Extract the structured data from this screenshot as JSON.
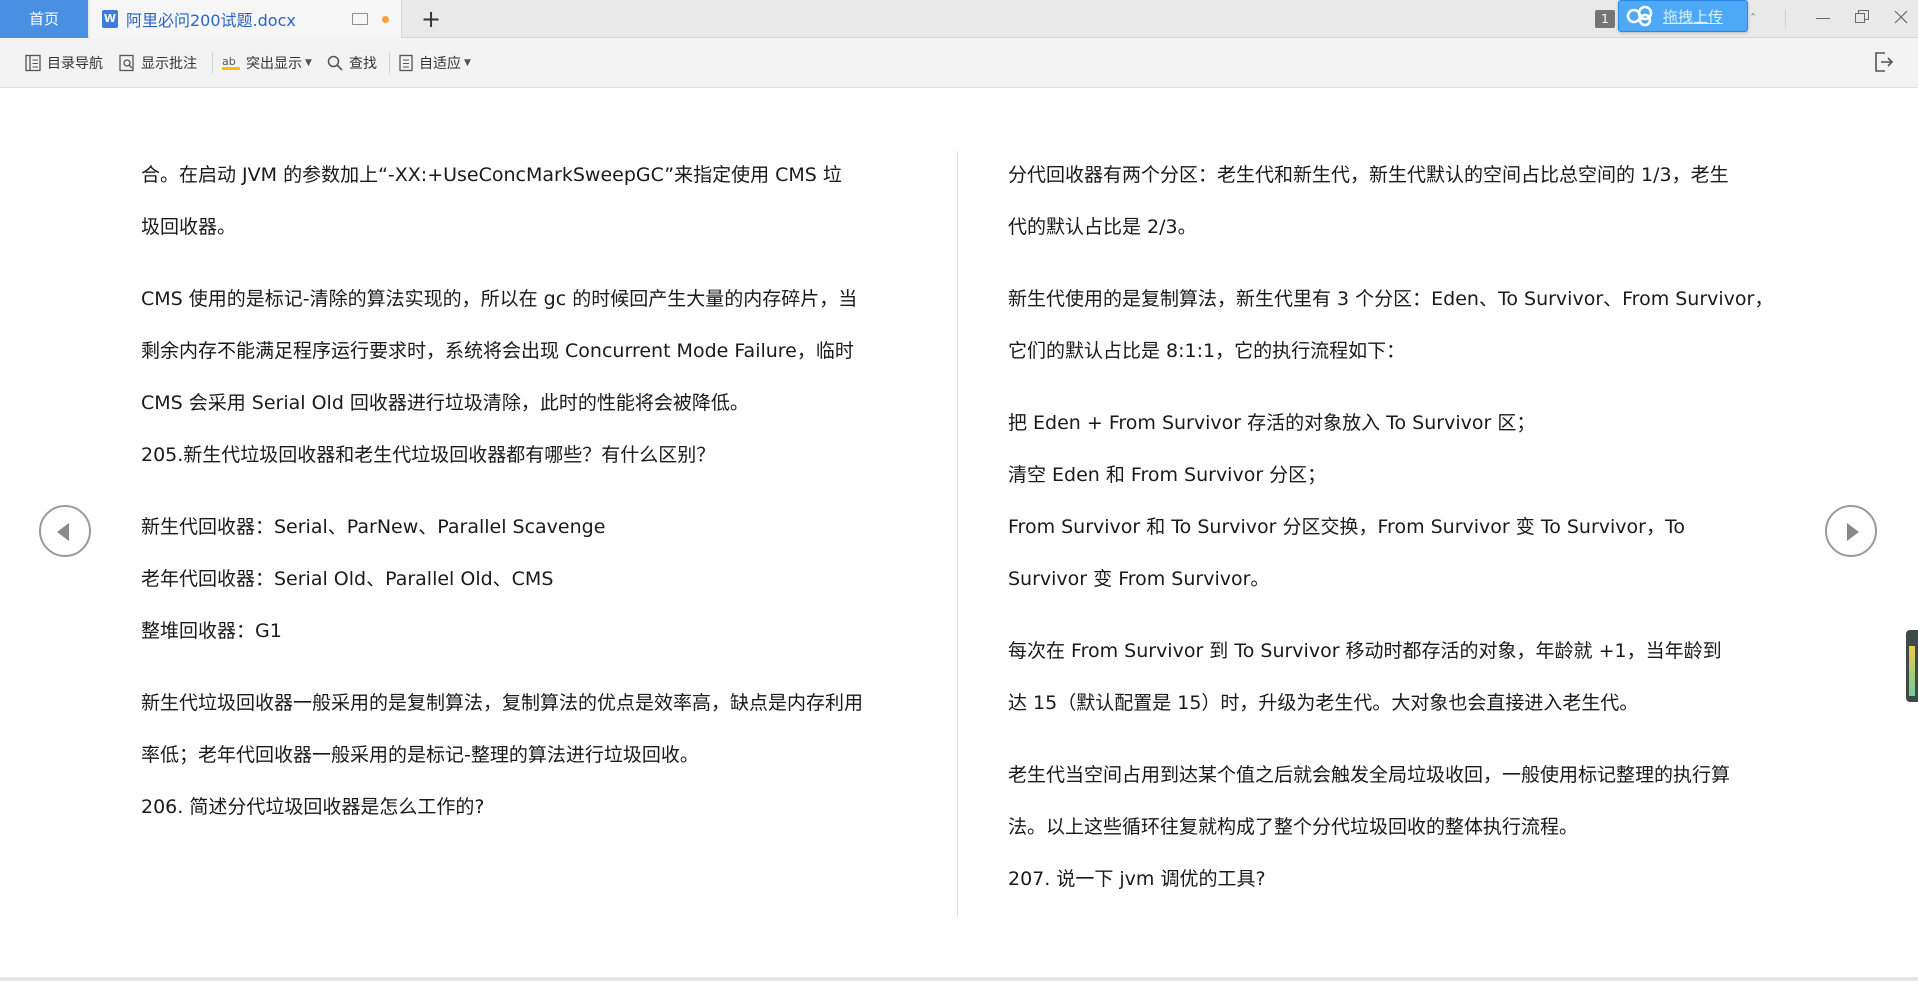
{
  "tabs": {
    "home_label": "首页",
    "doc_label": "阿里必问200试题.docx",
    "add_label": "+"
  },
  "titlebar": {
    "page_count": "1",
    "upload_label": "拖拽上传",
    "chevron": "ˆ"
  },
  "toolbar": {
    "toc_label": "目录导航",
    "comments_label": "显示批注",
    "highlight_label": "突出显示",
    "find_label": "查找",
    "fit_label": "自适应"
  },
  "colors": {
    "home_tab": "#4a90e2",
    "doc_tab_text": "#2a64c4",
    "modified_dot": "#f4a23c",
    "upload_button": "#4ea8f5"
  },
  "icons": {
    "prev_page": "chevron-left-circle-icon",
    "next_page": "chevron-right-circle-icon",
    "exit_reading": "exit-icon"
  },
  "document": {
    "left_lines": [
      "合。在启动 JVM 的参数加上“-XX:+UseConcMarkSweepGC”来指定使用 CMS 垃",
      "圾回收器。",
      "CMS 使用的是标记-清除的算法实现的，所以在 gc 的时候回产生大量的内存碎片，当",
      "剩余内存不能满足程序运行要求时，系统将会出现 Concurrent Mode Failure，临时",
      "CMS 会采用 Serial Old 回收器进行垃圾清除，此时的性能将会被降低。",
      "205.新生代垃圾回收器和老生代垃圾回收器都有哪些？有什么区别？",
      "新生代回收器：Serial、ParNew、Parallel Scavenge",
      "老年代回收器：Serial Old、Parallel Old、CMS",
      "整堆回收器：G1",
      "新生代垃圾回收器一般采用的是复制算法，复制算法的优点是效率高，缺点是内存利用",
      "率低；老年代回收器一般采用的是标记-整理的算法进行垃圾回收。",
      "206. 简述分代垃圾回收器是怎么工作的?"
    ],
    "right_lines": [
      "分代回收器有两个分区：老生代和新生代，新生代默认的空间占比总空间的 1/3，老生",
      "代的默认占比是 2/3。",
      "新生代使用的是复制算法，新生代里有 3 个分区：Eden、To Survivor、From Survivor，",
      "它们的默认占比是 8:1:1，它的执行流程如下：",
      "把 Eden + From Survivor 存活的对象放入 To Survivor 区；",
      "清空 Eden 和 From Survivor 分区；",
      "From Survivor 和 To Survivor 分区交换，From Survivor 变 To Survivor，To",
      "Survivor 变 From Survivor。",
      "每次在 From Survivor 到 To Survivor 移动时都存活的对象，年龄就 +1，当年龄到",
      "达 15（默认配置是 15）时，升级为老生代。大对象也会直接进入老生代。",
      "老生代当空间占用到达某个值之后就会触发全局垃圾收回，一般使用标记整理的执行算",
      "法。以上这些循环往复就构成了整个分代垃圾回收的整体执行流程。",
      "207. 说一下 jvm 调优的工具?"
    ]
  }
}
